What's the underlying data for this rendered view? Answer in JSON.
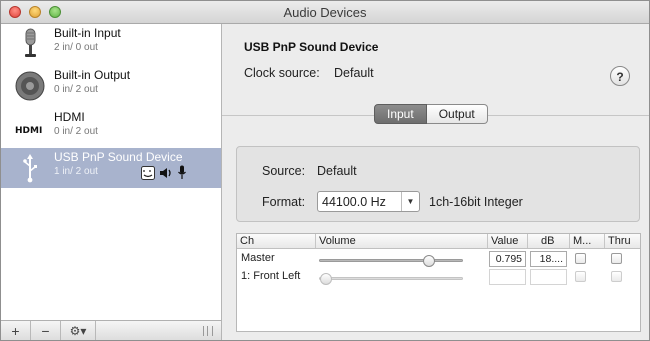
{
  "window": {
    "title": "Audio Devices"
  },
  "sidebar": {
    "devices": [
      {
        "name": "Built-in Input",
        "io": "2 in/ 0 out",
        "icon": "microphone-icon"
      },
      {
        "name": "Built-in Output",
        "io": "0 in/ 2 out",
        "icon": "speaker-icon"
      },
      {
        "name": "HDMI",
        "io": "0 in/ 2 out",
        "icon": "hdmi-icon"
      },
      {
        "name": "USB PnP Sound Device",
        "io": "1 in/ 2 out",
        "icon": "usb-icon",
        "selected": true
      }
    ],
    "bottom_bar": {
      "add": "+",
      "remove": "−",
      "gear": "⚙▾"
    }
  },
  "detail": {
    "device_title": "USB PnP Sound Device",
    "clock_label": "Clock source:",
    "clock_value": "Default",
    "help_label": "?",
    "tabs": [
      {
        "label": "Input",
        "active": true
      },
      {
        "label": "Output",
        "active": false
      }
    ],
    "source_label": "Source:",
    "source_value": "Default",
    "format_label": "Format:",
    "format_value": "44100.0 Hz",
    "format_type": "1ch-16bit Integer"
  },
  "channels_table": {
    "columns": [
      "Ch",
      "Volume",
      "Value",
      "dB",
      "M...",
      "Thru"
    ],
    "rows": [
      {
        "name": "Master",
        "volume": 0.795,
        "value": "0.795",
        "db": "18....",
        "mute": false,
        "thru": false,
        "enabled": true
      },
      {
        "name": "1: Front Left",
        "volume": 0.0,
        "value": "",
        "db": "",
        "mute": false,
        "thru": false,
        "enabled": false
      }
    ]
  },
  "colors": {
    "selection": "#a8b3cd",
    "tab_active": "#7d7d7d"
  }
}
